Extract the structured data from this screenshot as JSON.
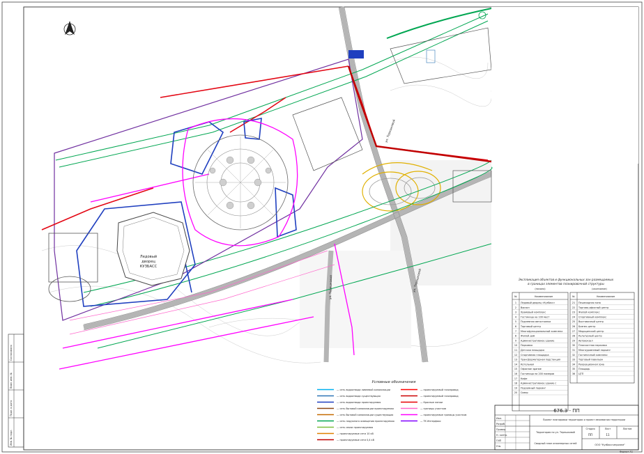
{
  "map": {
    "arena_name_line1": "Ледовый",
    "arena_name_line2": "дворец",
    "arena_name_line3": "КУЗБАСС",
    "street_label_1": "ул. Терешковой",
    "street_label_2": "ул. Терешковой",
    "street_label_3": "ул. Терешковой"
  },
  "explication": {
    "title_line1": "Экспликация объектов и функциональных зон размещаемых",
    "title_line2": "в границах элементов планировочной структуры",
    "left_header": "(начало)",
    "right_header": "(окончание)",
    "col_no": "№",
    "col_name": "Наименование",
    "left_rows": [
      {
        "no": "1",
        "name": "Ледовый дворец «Кузбасс»"
      },
      {
        "no": "2",
        "name": "Вокзал"
      },
      {
        "no": "3",
        "name": "Храмовый комплекс"
      },
      {
        "no": "4",
        "name": "Гостиница на 100 мест"
      },
      {
        "no": "5",
        "name": "Подземная автостоянка"
      },
      {
        "no": "6",
        "name": "Торговый центр"
      },
      {
        "no": "7",
        "name": "Многофункциональный комплекс"
      },
      {
        "no": "8",
        "name": "Жилой дом"
      },
      {
        "no": "9",
        "name": "Административное здание"
      },
      {
        "no": "10",
        "name": "Парковка"
      },
      {
        "no": "11",
        "name": "Детская площадка"
      },
      {
        "no": "12",
        "name": "Спортивная площадка"
      },
      {
        "no": "13",
        "name": "Трансформаторная подстанция"
      },
      {
        "no": "14",
        "name": "Котельная"
      },
      {
        "no": "15",
        "name": "Офисное здание"
      },
      {
        "no": "16",
        "name": "Гостиница на 200 номеров"
      },
      {
        "no": "17",
        "name": "Кафе"
      },
      {
        "no": "18",
        "name": "Административное здание с"
      },
      {
        "no": "19",
        "name": "Подземный паркинг"
      },
      {
        "no": "20",
        "name": "Сквер"
      }
    ],
    "right_rows": [
      {
        "no": "21",
        "name": "Пешеходная зона"
      },
      {
        "no": "22",
        "name": "Торгово-офисный центр"
      },
      {
        "no": "23",
        "name": "Жилой комплекс"
      },
      {
        "no": "24",
        "name": "Спортивный комплекс"
      },
      {
        "no": "25",
        "name": "Выставочный центр"
      },
      {
        "no": "26",
        "name": "Бизнес-центр"
      },
      {
        "no": "27",
        "name": "Медицинский центр"
      },
      {
        "no": "28",
        "name": "Культурный центр"
      },
      {
        "no": "29",
        "name": "Автовокзал"
      },
      {
        "no": "30",
        "name": "Плоскостная парковка"
      },
      {
        "no": "31",
        "name": "Многоуровневый паркинг"
      },
      {
        "no": "32",
        "name": "Гостиничный комплекс"
      },
      {
        "no": "33",
        "name": "Торговый павильон"
      },
      {
        "no": "34",
        "name": "Рекреационная зона"
      },
      {
        "no": "35",
        "name": "Площадь"
      },
      {
        "no": "36",
        "name": "ЦТП"
      }
    ]
  },
  "legend": {
    "title": "Условные обозначения",
    "left_items": [
      {
        "label": "— сеть водоотвода ливневой канализации",
        "color": "#00b0f0"
      },
      {
        "label": "— сеть водоотвода существующая",
        "color": "#2e75b6"
      },
      {
        "label": "— сеть водоотвода проектируемая",
        "color": "#1f3fbf"
      },
      {
        "label": "— сеть бытовой канализации проектируемая",
        "color": "#8b4513"
      },
      {
        "label": "— сеть бытовой канализации существующая",
        "color": "#c46a00"
      },
      {
        "label": "— сеть наружного освещения проектируемая",
        "color": "#00a651"
      },
      {
        "label": "— сеть связи проектируемая",
        "color": "#7fbf3f"
      },
      {
        "label": "— проектируемые сети 10 кВ",
        "color": "#e08000"
      },
      {
        "label": "— проектируемые сети 0,4 кВ",
        "color": "#c00000"
      }
    ],
    "right_items": [
      {
        "label": "— проектируемый газопровод",
        "color": "#ff0000"
      },
      {
        "label": "— проектируемый газопровод",
        "color": "#cc0000"
      },
      {
        "label": "— Красные линии",
        "color": "#e60000"
      },
      {
        "label": "— границы участков",
        "color": "#ff66cc"
      },
      {
        "label": "— проектируемые границы участков",
        "color": "#ff00ff"
      },
      {
        "label": "— ТК Интерфакс",
        "color": "#8000ff"
      }
    ]
  },
  "title_block": {
    "doc_code": "676.3 - ПП",
    "description": "Проект планировки территории и проект межевания территории",
    "sheet_subject": "Территория по ул. Терешковой",
    "drawing_title": "Сводный план инженерных сетей",
    "company": "ООО \"Кузбассгипрозем\"",
    "stage_label": "Стадия",
    "sheet_label": "Лист",
    "sheets_label": "Листов",
    "stage_value": "ПП",
    "sheet_value": "11",
    "roles": [
      "Изм.",
      "Разраб.",
      "Провер.",
      "Н. контр.",
      "ГИП",
      "Утв."
    ]
  },
  "side_stamp": {
    "labels": [
      "Инв. № подл.",
      "Подп. и дата",
      "Взам. инв. №",
      "Согласовано"
    ]
  },
  "footer": {
    "format": "Формат А1"
  },
  "colors": {
    "red_line": "#e30613",
    "magenta": "#ff00ff",
    "blue": "#1f3fbf",
    "green": "#00a651",
    "purple": "#7030a0",
    "road_gray": "#b8b8b8",
    "map_gray": "#9a9a9a"
  }
}
